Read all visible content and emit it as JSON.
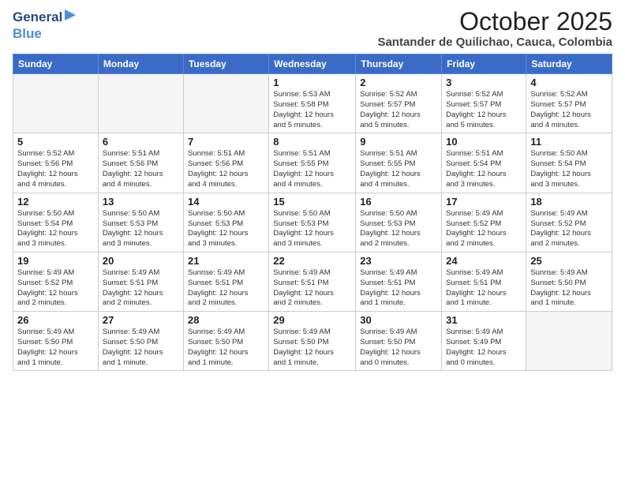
{
  "logo": {
    "general": "General",
    "blue": "Blue"
  },
  "header": {
    "month": "October 2025",
    "location": "Santander de Quilichao, Cauca, Colombia"
  },
  "weekdays": [
    "Sunday",
    "Monday",
    "Tuesday",
    "Wednesday",
    "Thursday",
    "Friday",
    "Saturday"
  ],
  "weeks": [
    [
      {
        "day": "",
        "text": ""
      },
      {
        "day": "",
        "text": ""
      },
      {
        "day": "",
        "text": ""
      },
      {
        "day": "1",
        "text": "Sunrise: 5:53 AM\nSunset: 5:58 PM\nDaylight: 12 hours\nand 5 minutes."
      },
      {
        "day": "2",
        "text": "Sunrise: 5:52 AM\nSunset: 5:57 PM\nDaylight: 12 hours\nand 5 minutes."
      },
      {
        "day": "3",
        "text": "Sunrise: 5:52 AM\nSunset: 5:57 PM\nDaylight: 12 hours\nand 5 minutes."
      },
      {
        "day": "4",
        "text": "Sunrise: 5:52 AM\nSunset: 5:57 PM\nDaylight: 12 hours\nand 4 minutes."
      }
    ],
    [
      {
        "day": "5",
        "text": "Sunrise: 5:52 AM\nSunset: 5:56 PM\nDaylight: 12 hours\nand 4 minutes."
      },
      {
        "day": "6",
        "text": "Sunrise: 5:51 AM\nSunset: 5:56 PM\nDaylight: 12 hours\nand 4 minutes."
      },
      {
        "day": "7",
        "text": "Sunrise: 5:51 AM\nSunset: 5:56 PM\nDaylight: 12 hours\nand 4 minutes."
      },
      {
        "day": "8",
        "text": "Sunrise: 5:51 AM\nSunset: 5:55 PM\nDaylight: 12 hours\nand 4 minutes."
      },
      {
        "day": "9",
        "text": "Sunrise: 5:51 AM\nSunset: 5:55 PM\nDaylight: 12 hours\nand 4 minutes."
      },
      {
        "day": "10",
        "text": "Sunrise: 5:51 AM\nSunset: 5:54 PM\nDaylight: 12 hours\nand 3 minutes."
      },
      {
        "day": "11",
        "text": "Sunrise: 5:50 AM\nSunset: 5:54 PM\nDaylight: 12 hours\nand 3 minutes."
      }
    ],
    [
      {
        "day": "12",
        "text": "Sunrise: 5:50 AM\nSunset: 5:54 PM\nDaylight: 12 hours\nand 3 minutes."
      },
      {
        "day": "13",
        "text": "Sunrise: 5:50 AM\nSunset: 5:53 PM\nDaylight: 12 hours\nand 3 minutes."
      },
      {
        "day": "14",
        "text": "Sunrise: 5:50 AM\nSunset: 5:53 PM\nDaylight: 12 hours\nand 3 minutes."
      },
      {
        "day": "15",
        "text": "Sunrise: 5:50 AM\nSunset: 5:53 PM\nDaylight: 12 hours\nand 3 minutes."
      },
      {
        "day": "16",
        "text": "Sunrise: 5:50 AM\nSunset: 5:53 PM\nDaylight: 12 hours\nand 2 minutes."
      },
      {
        "day": "17",
        "text": "Sunrise: 5:49 AM\nSunset: 5:52 PM\nDaylight: 12 hours\nand 2 minutes."
      },
      {
        "day": "18",
        "text": "Sunrise: 5:49 AM\nSunset: 5:52 PM\nDaylight: 12 hours\nand 2 minutes."
      }
    ],
    [
      {
        "day": "19",
        "text": "Sunrise: 5:49 AM\nSunset: 5:52 PM\nDaylight: 12 hours\nand 2 minutes."
      },
      {
        "day": "20",
        "text": "Sunrise: 5:49 AM\nSunset: 5:51 PM\nDaylight: 12 hours\nand 2 minutes."
      },
      {
        "day": "21",
        "text": "Sunrise: 5:49 AM\nSunset: 5:51 PM\nDaylight: 12 hours\nand 2 minutes."
      },
      {
        "day": "22",
        "text": "Sunrise: 5:49 AM\nSunset: 5:51 PM\nDaylight: 12 hours\nand 2 minutes."
      },
      {
        "day": "23",
        "text": "Sunrise: 5:49 AM\nSunset: 5:51 PM\nDaylight: 12 hours\nand 1 minute."
      },
      {
        "day": "24",
        "text": "Sunrise: 5:49 AM\nSunset: 5:51 PM\nDaylight: 12 hours\nand 1 minute."
      },
      {
        "day": "25",
        "text": "Sunrise: 5:49 AM\nSunset: 5:50 PM\nDaylight: 12 hours\nand 1 minute."
      }
    ],
    [
      {
        "day": "26",
        "text": "Sunrise: 5:49 AM\nSunset: 5:50 PM\nDaylight: 12 hours\nand 1 minute."
      },
      {
        "day": "27",
        "text": "Sunrise: 5:49 AM\nSunset: 5:50 PM\nDaylight: 12 hours\nand 1 minute."
      },
      {
        "day": "28",
        "text": "Sunrise: 5:49 AM\nSunset: 5:50 PM\nDaylight: 12 hours\nand 1 minute."
      },
      {
        "day": "29",
        "text": "Sunrise: 5:49 AM\nSunset: 5:50 PM\nDaylight: 12 hours\nand 1 minute."
      },
      {
        "day": "30",
        "text": "Sunrise: 5:49 AM\nSunset: 5:50 PM\nDaylight: 12 hours\nand 0 minutes."
      },
      {
        "day": "31",
        "text": "Sunrise: 5:49 AM\nSunset: 5:49 PM\nDaylight: 12 hours\nand 0 minutes."
      },
      {
        "day": "",
        "text": ""
      }
    ]
  ]
}
